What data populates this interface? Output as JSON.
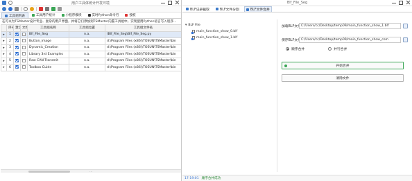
{
  "left_window": {
    "title": "用户工具体统计开发环境",
    "toolbar": {
      "buttons": [
        {
          "label": "工具组列表",
          "icon": "list-icon"
        },
        {
          "label": "工具用户统计",
          "icon": "play-icon"
        },
        {
          "label": "小程序模块",
          "icon": "check-icon"
        },
        {
          "label": "实时Python命令行",
          "icon": "terminal-icon"
        },
        {
          "label": "授权",
          "icon": "stop-icon"
        }
      ]
    },
    "tabs": [
      {
        "label": "工具组列表",
        "active": true
      },
      {
        "label": "工具用户统计",
        "active": false
      },
      {
        "label": "小程序模块",
        "active": false
      },
      {
        "label": "实时Python命令行",
        "active": false
      },
      {
        "label": "授权",
        "active": false
      }
    ],
    "description": "在可以为TSMaster设计专业、复杂的用户界面，并将它们添加到TSMaster内置工具组中，实现使用Python语言写入程序...",
    "table": {
      "headers": [
        "序号",
        "激活",
        "文档",
        "工具组名称",
        "工具组位置",
        "工具组文件名"
      ],
      "rows": [
        {
          "index": "1",
          "active": true,
          "doc": false,
          "name": "Blf_File_Seg",
          "location": "n.a.",
          "file": "\\Blf_File_Seg\\Blf_File_Seg.py",
          "selected": true
        },
        {
          "index": "2",
          "active": true,
          "doc": false,
          "name": "Button_image",
          "location": "n.a.",
          "file": "d:\\Program Files (x86)\\TOSUN\\TSMaster\\bin",
          "selected": false
        },
        {
          "index": "3",
          "active": true,
          "doc": false,
          "name": "Dynamic_Creation",
          "location": "n.a.",
          "file": "d:\\Program Files (x86)\\TOSUN\\TSMaster\\bin",
          "selected": false
        },
        {
          "index": "4",
          "active": true,
          "doc": false,
          "name": "Library 3rd Examples",
          "location": "n.a.",
          "file": "d:\\Program Files (x86)\\TOSUN\\TSMaster\\bin",
          "selected": false
        },
        {
          "index": "5",
          "active": true,
          "doc": false,
          "name": "Raw CAN Transmit",
          "location": "n.a.",
          "file": "d:\\Program Files (x86)\\TOSUN\\TSMaster\\bin",
          "selected": false
        },
        {
          "index": "6",
          "active": true,
          "doc": false,
          "name": "Toolbox Guide",
          "location": "n.a.",
          "file": "d:\\Program Files (x86)\\TOSUN\\TSMaster\\bin",
          "selected": false
        }
      ]
    }
  },
  "right_window": {
    "title": "Blf_File_Seg",
    "tabs": [
      {
        "label": "BLF记录截取",
        "active": false
      },
      {
        "label": "BLF文件分割",
        "active": false
      },
      {
        "label": "BLF文件合并",
        "active": true
      }
    ],
    "tree": {
      "root": "BLF File",
      "children": [
        "main_function_show_0.blf",
        "main_function_show_1.blf"
      ]
    },
    "form": {
      "load_label": "加载BLF文件",
      "load_value": "C:/Users/cc/Desktop/temp09/main_function_show_1.blf",
      "save_label": "保存BLF文件",
      "save_value": "C:/Users/cc/Desktop/temp09/main_function_show_com",
      "radio_sequential": "顺序合并",
      "radio_parallel": "并行合并",
      "selected_mode": "sequential",
      "start_button": "开始合并",
      "clear_button": "清除文件"
    },
    "status": {
      "time": "17:19:01",
      "message": "顺序合并成功"
    }
  },
  "colors": {
    "accent_blue": "#2f6fd1",
    "success_green": "#2e8b3a",
    "selected_row": "#dfe9f7"
  }
}
